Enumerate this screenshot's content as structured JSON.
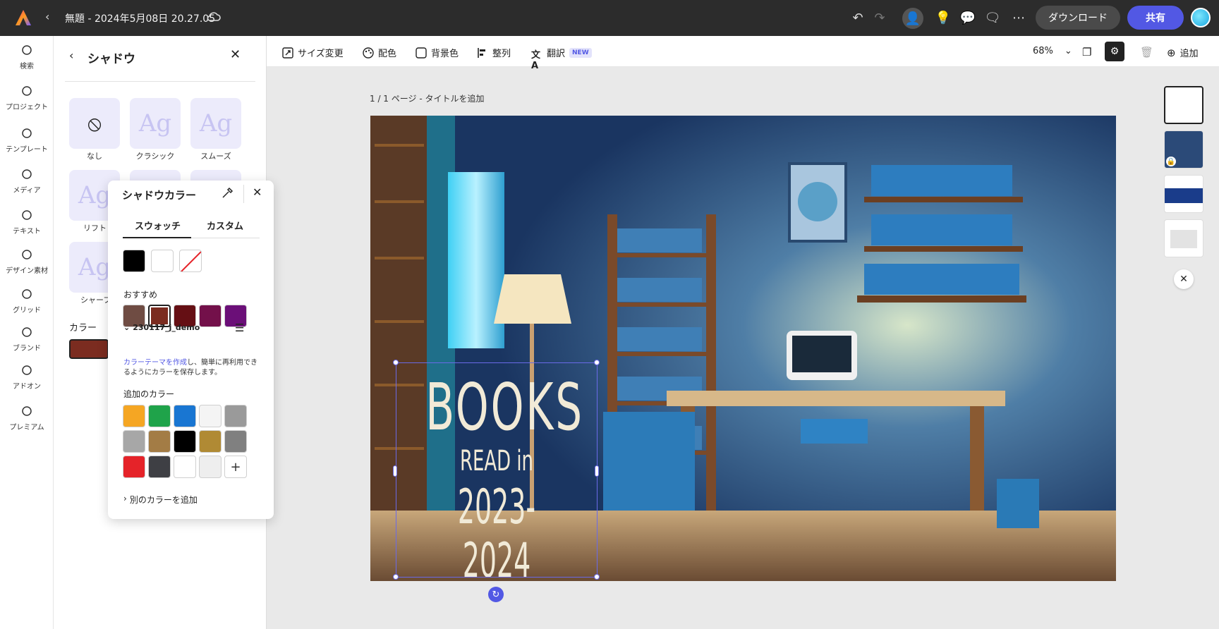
{
  "header": {
    "doc_title": "無題 - 2024年5月08日 20.27.05",
    "download_label": "ダウンロード",
    "share_label": "共有"
  },
  "rail": {
    "items": [
      {
        "label": "検索",
        "icon": "search-icon"
      },
      {
        "label": "プロジェクト",
        "icon": "folder-icon"
      },
      {
        "label": "テンプレート",
        "icon": "template-icon"
      },
      {
        "label": "メディア",
        "icon": "media-icon"
      },
      {
        "label": "テキスト",
        "icon": "text-icon"
      },
      {
        "label": "デザイン素材",
        "icon": "shapes-icon"
      },
      {
        "label": "グリッド",
        "icon": "grid-icon"
      },
      {
        "label": "ブランド",
        "icon": "brand-icon"
      },
      {
        "label": "アドオン",
        "icon": "addon-icon"
      },
      {
        "label": "プレミアム",
        "icon": "crown-icon"
      }
    ]
  },
  "panel": {
    "title": "シャドウ",
    "tiles": [
      {
        "label": "なし",
        "glyph": "⦸"
      },
      {
        "label": "クラシック",
        "glyph": "Ag"
      },
      {
        "label": "スムーズ",
        "glyph": "Ag"
      },
      {
        "label": "リフト",
        "glyph": "Ag"
      },
      {
        "label": "シャープ",
        "glyph": "Ag"
      }
    ],
    "color_label": "カラー",
    "color_value": "#7b2c20"
  },
  "popover": {
    "title": "シャドウカラー",
    "tab_swatch": "スウォッチ",
    "tab_custom": "カスタム",
    "recommended_label": "おすすめ",
    "recommended": [
      "#6f4c43",
      "#7b2c20",
      "#650f14",
      "#73104a",
      "#6b0f78"
    ],
    "theme_name": "230117_j_demo",
    "desc_link": "カラーテーマを作成",
    "desc_rest": "し、簡単に再利用できるようにカラーを保存します。",
    "extra_label": "追加のカラー",
    "extra": [
      "#f5a623",
      "#1fa34a",
      "#1976d2",
      "#f4f4f4",
      "#9a9a9a",
      "#a7a7a7",
      "#a37c45",
      "#000000",
      "#b08a34",
      "#808080",
      "#e52329",
      "#3e3f44",
      "#ffffff",
      "#eeeeee"
    ],
    "add_other": "別のカラーを追加"
  },
  "toolbar": {
    "resize": "サイズ変更",
    "colors": "配色",
    "bg": "背景色",
    "align": "整列",
    "translate": "翻訳",
    "new_badge": "NEW",
    "zoom": "68%",
    "add": "追加"
  },
  "canvas": {
    "page_label": "1 / 1 ページ - タイトルを追加",
    "line1": "BOOKS",
    "line2": "READ in",
    "line3": "2023-2024"
  }
}
